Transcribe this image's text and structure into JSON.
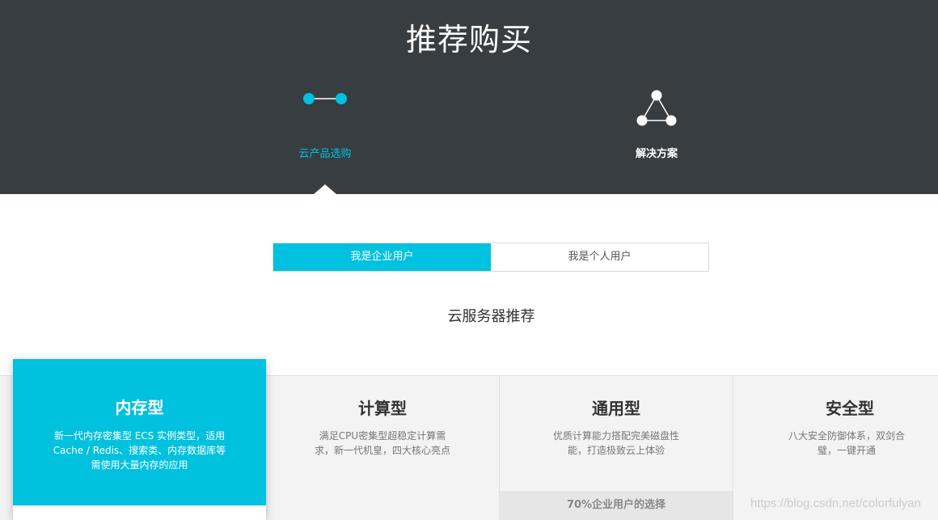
{
  "header": {
    "title": "推荐购买",
    "categories": [
      {
        "label": "云产品选购",
        "icon": "product-link-icon",
        "active": true
      },
      {
        "label": "解决方案",
        "icon": "solution-triangle-icon",
        "active": false
      }
    ]
  },
  "user_type_tabs": [
    {
      "label": "我是企业用户",
      "active": true
    },
    {
      "label": "我是个人用户",
      "active": false
    }
  ],
  "section_title": "云服务器推荐",
  "server_types": [
    {
      "name": "内存型",
      "description": "新一代内存密集型 ECS 实例类型，适用 Cache / Redis、搜索类、内存数据库等需使用大量内存的应用",
      "selected": true
    },
    {
      "name": "计算型",
      "description": "满足CPU密集型超稳定计算需求，新一代机皇，四大核心亮点",
      "selected": false
    },
    {
      "name": "通用型",
      "description": "优质计算能力搭配完美磁盘性能，打造极致云上体验",
      "selected": false,
      "badge": "70%企业用户的选择"
    },
    {
      "name": "安全型",
      "description": "八大安全防御体系，双剑合璧，一键开通",
      "selected": false
    }
  ],
  "watermark": "https://blog.csdn.net/colorfulyan",
  "colors": {
    "accent": "#00c1de",
    "hero_bg": "#373d41",
    "panel_bg": "#f3f3f3"
  }
}
